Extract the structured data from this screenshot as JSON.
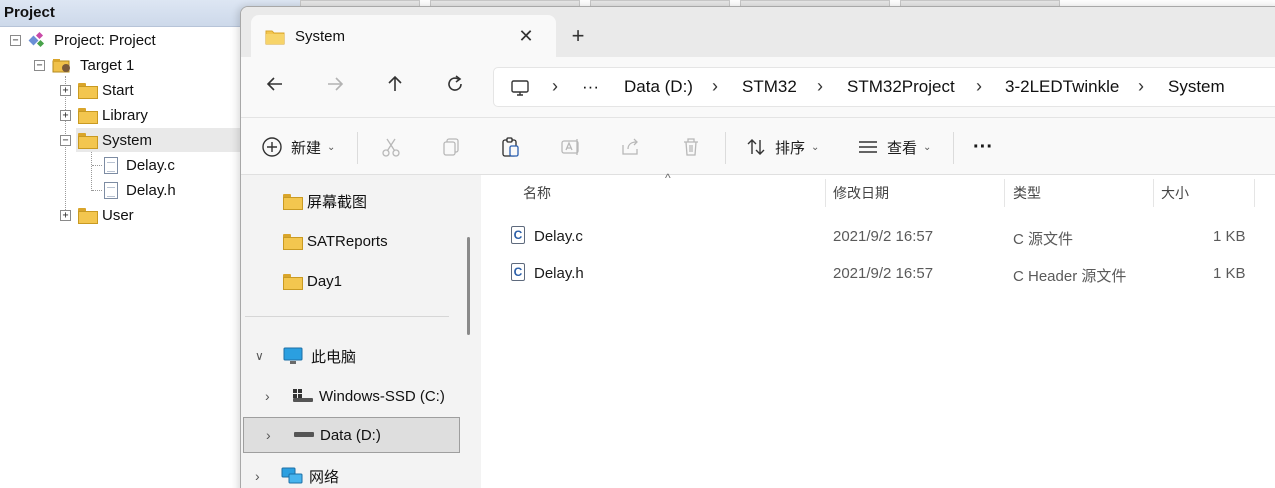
{
  "keil": {
    "panel_title": "Project",
    "tree": {
      "project": "Project: Project",
      "target": "Target 1",
      "groups": [
        {
          "label": "Start"
        },
        {
          "label": "Library"
        },
        {
          "label": "System"
        },
        {
          "label": "User"
        }
      ],
      "files": [
        "Delay.c",
        "Delay.h"
      ]
    }
  },
  "explorer": {
    "tab": {
      "title": "System",
      "close_glyph": "✕",
      "new_tab_glyph": "+"
    },
    "address": {
      "ellipsis": "···",
      "crumbs": [
        "Data (D:)",
        "STM32",
        "STM32Project",
        "3-2LEDTwinkle",
        "System"
      ]
    },
    "commands": {
      "new": "新建",
      "sort": "排序",
      "view": "查看",
      "more": "···"
    },
    "nav": {
      "quick": [
        "屏幕截图",
        "SATReports",
        "Day1"
      ],
      "this_pc": "此电脑",
      "drives": [
        "Windows-SSD (C:)",
        "Data (D:)"
      ],
      "network": "网络"
    },
    "columns": {
      "name": "名称",
      "modified": "修改日期",
      "type": "类型",
      "size": "大小"
    },
    "files": [
      {
        "name": "Delay.c",
        "modified": "2021/9/2 16:57",
        "type": "C 源文件",
        "size": "1 KB",
        "icon_glyph": "C"
      },
      {
        "name": "Delay.h",
        "modified": "2021/9/2 16:57",
        "type": "C Header 源文件",
        "size": "1 KB",
        "icon_glyph": "C"
      }
    ]
  }
}
